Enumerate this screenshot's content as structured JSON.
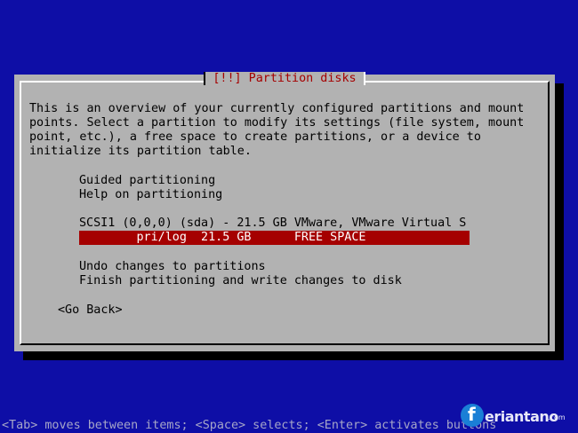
{
  "dialog": {
    "title": "[!!] Partition disks",
    "intro": [
      "This is an overview of your currently configured partitions and mount",
      "points. Select a partition to modify its settings (file system, mount",
      "point, etc.), a free space to create partitions, or a device to",
      "initialize its partition table."
    ],
    "menu": {
      "guided": "Guided partitioning",
      "help": "Help on partitioning",
      "disk": "SCSI1 (0,0,0) (sda) - 21.5 GB VMware, VMware Virtual S",
      "free_space": "        pri/log  21.5 GB      FREE SPACE",
      "undo": "Undo changes to partitions",
      "finish": "Finish partitioning and write changes to disk"
    },
    "go_back": "<Go Back>"
  },
  "status_bar": "<Tab> moves between items; <Space> selects; <Enter> activates buttons",
  "watermark": {
    "initial": "f",
    "text": "eriantano",
    "suffix": ".com"
  },
  "colors": {
    "background": "#0e0ea6",
    "dialog": "#b2b2b2",
    "highlight": "#a50000",
    "title_text": "#a50000"
  }
}
